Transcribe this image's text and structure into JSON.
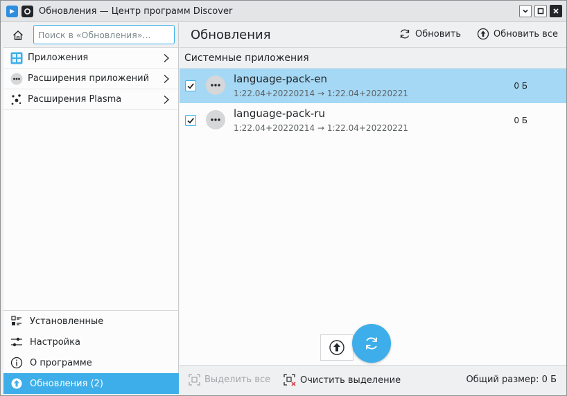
{
  "window": {
    "title": "Обновления — Центр программ Discover",
    "app_icon": "discover-icon",
    "controls": [
      "minimize-icon",
      "maximize-icon",
      "close-icon"
    ]
  },
  "sidebar": {
    "search_placeholder": "Поиск в «Обновления»...",
    "categories": [
      {
        "label": "Приложения",
        "icon": "applications-grid-icon"
      },
      {
        "label": "Расширения приложений",
        "icon": "dots-icon"
      },
      {
        "label": "Расширения Plasma",
        "icon": "plasma-icon"
      }
    ],
    "nav": [
      {
        "label": "Установленные",
        "icon": "installed-list-icon"
      },
      {
        "label": "Настройка",
        "icon": "settings-sliders-icon"
      },
      {
        "label": "О программе",
        "icon": "info-icon"
      },
      {
        "label": "Обновления (2)",
        "icon": "updates-icon",
        "active": true
      }
    ]
  },
  "header": {
    "title": "Обновления",
    "refresh_label": "Обновить",
    "update_all_label": "Обновить все"
  },
  "section": {
    "title": "Системные приложения"
  },
  "packages": [
    {
      "name": "language-pack-en",
      "version": "1:22.04+20220214 → 1:22.04+20220221",
      "size": "0 Б",
      "checked": true,
      "selected": true
    },
    {
      "name": "language-pack-ru",
      "version": "1:22.04+20220214 → 1:22.04+20220221",
      "size": "0 Б",
      "checked": true,
      "selected": false
    }
  ],
  "footer": {
    "select_all_label": "Выделить все",
    "clear_selection_label": "Очистить выделение",
    "total_size_label": "Общий размер: 0 Б"
  },
  "colors": {
    "accent": "#3daee9",
    "selection": "#a5d8f4",
    "clear_icon_red": "#da4453"
  }
}
